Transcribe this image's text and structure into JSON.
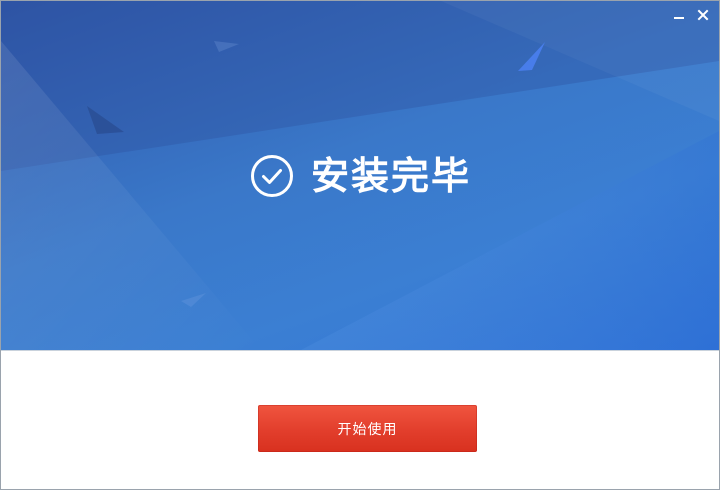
{
  "window": {
    "controls": {
      "minimize_icon": "minimize-icon",
      "close_icon": "close-icon"
    }
  },
  "banner": {
    "status_icon": "check-circle-icon",
    "title": "安装完毕"
  },
  "footer": {
    "start_button_label": "开始使用"
  },
  "colors": {
    "banner_blue": "#3a78c9",
    "button_red": "#e23e2c",
    "text_white": "#ffffff"
  }
}
